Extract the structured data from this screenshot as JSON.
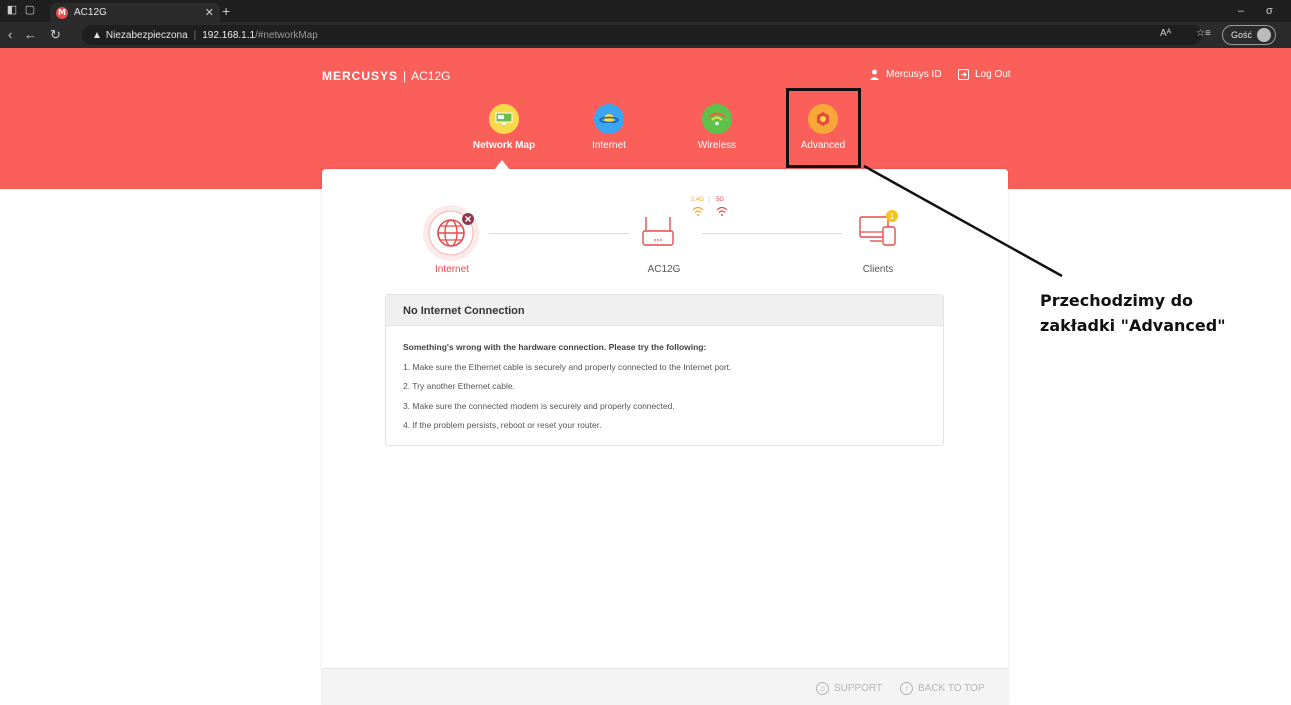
{
  "browser": {
    "tab_title": "AC12G",
    "tab_favicon": "M",
    "insecure_label": "Niezabezpieczona",
    "url_host": "192.168.1.1",
    "url_path": "/#networkMap",
    "guest_label": "Gość",
    "read_aloud": "Aᴬ"
  },
  "header": {
    "brand": "MERCUSYS",
    "model": "AC12G",
    "mercusys_id": "Mercusys ID",
    "logout": "Log Out"
  },
  "nav": {
    "items": [
      {
        "label": "Network Map",
        "icon": "network-map-icon",
        "color": "#f8d94a"
      },
      {
        "label": "Internet",
        "icon": "internet-planet-icon",
        "color": "#3aa6f2"
      },
      {
        "label": "Wireless",
        "icon": "wifi-icon",
        "color": "#5dc24a"
      },
      {
        "label": "Advanced",
        "icon": "advanced-gear-icon",
        "color": "#f7a83a"
      }
    ],
    "active": "Network Map"
  },
  "topology": {
    "internet_label": "Internet",
    "router_label": "AC12G",
    "clients_label": "Clients",
    "band_24": "2.4G",
    "band_5": "5G",
    "clients_count": "1"
  },
  "status_panel": {
    "title": "No Internet Connection",
    "intro": "Something's wrong with the hardware connection. Please try the following:",
    "steps": [
      "1. Make sure the Ethernet cable is securely and properly connected to the Internet port.",
      "2. Try another Ethernet cable.",
      "3. Make sure the connected modem is securely and properly connected.",
      "4. If the problem persists, reboot or reset your router."
    ]
  },
  "footer": {
    "support": "SUPPORT",
    "back_to_top": "BACK TO TOP"
  },
  "annotation": {
    "line1": "Przechodzimy do",
    "line2": "zakładki \"Advanced\""
  },
  "colors": {
    "brand_red": "#fb5f5a",
    "internet_error": "#e84c4c"
  }
}
